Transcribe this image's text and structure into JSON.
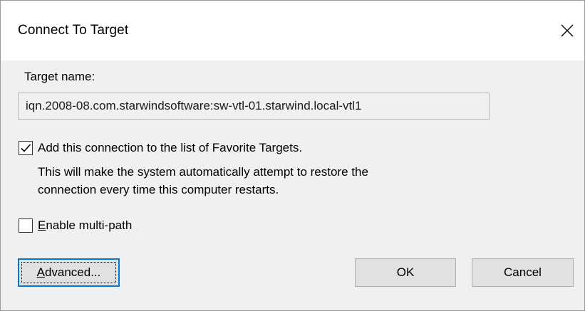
{
  "window": {
    "title": "Connect To Target",
    "close_icon": "close-icon"
  },
  "target": {
    "label": "Target name:",
    "value": "iqn.2008-08.com.starwindsoftware:sw-vtl-01.starwind.local-vtl1"
  },
  "favorite": {
    "checked": true,
    "label": "Add this connection to the list of Favorite Targets.",
    "description_line1": "This will make the system automatically attempt to restore the",
    "description_line2": "connection every time this computer restarts."
  },
  "multipath": {
    "checked": false,
    "label_mnemonic": "E",
    "label_rest": "nable multi-path"
  },
  "buttons": {
    "advanced_mnemonic": "A",
    "advanced_rest": "dvanced...",
    "ok": "OK",
    "cancel": "Cancel"
  },
  "colors": {
    "focus_accent": "#0078d7",
    "button_face": "#e1e1e1",
    "dialog_background": "#f0f0f0"
  }
}
